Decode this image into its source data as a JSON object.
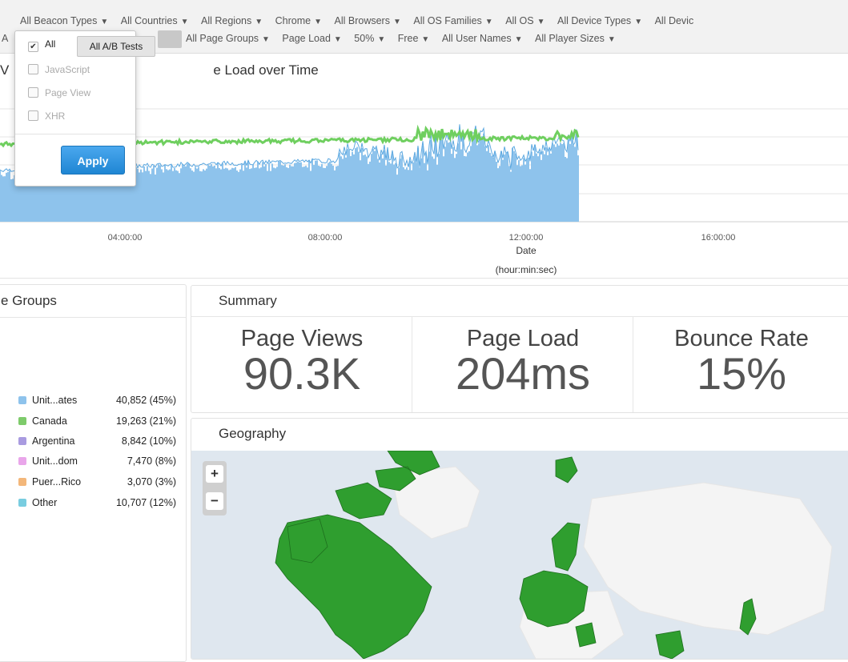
{
  "filters": {
    "row1": [
      "All Beacon Types",
      "All Countries",
      "All Regions",
      "Chrome",
      "All Browsers",
      "All OS Families",
      "All OS",
      "All Device Types",
      "All Devic"
    ],
    "row2_partial": "A",
    "row2": [
      "All Page Groups",
      "Page Load",
      "50%",
      "Free",
      "All User Names",
      "All Player Sizes"
    ]
  },
  "ab_dropdown": {
    "options": [
      {
        "label": "All",
        "checked": true
      },
      {
        "label": "JavaScript",
        "checked": false
      },
      {
        "label": "Page View",
        "checked": false
      },
      {
        "label": "XHR",
        "checked": false
      }
    ],
    "apply_label": "Apply",
    "tooltip": "All A/B Tests"
  },
  "chart": {
    "title_partial_1": "V",
    "title_partial_2": "e Load over Time",
    "xticks": [
      "04:00:00",
      "08:00:00",
      "12:00:00",
      "16:00:00"
    ],
    "xlabel": "Date",
    "xlabel_sub": "(hour:min:sec)",
    "colors": {
      "views": "#8ec3ec",
      "load": "#6fcf5f"
    }
  },
  "page_groups": {
    "title": "e Groups",
    "items": [
      {
        "name": "Unit...ates",
        "value": "40,852 (45%)",
        "color": "#8ec3ec"
      },
      {
        "name": "Canada",
        "value": "19,263 (21%)",
        "color": "#7ecb6b"
      },
      {
        "name": "Argentina",
        "value": "8,842 (10%)",
        "color": "#a99be0"
      },
      {
        "name": "Unit...dom",
        "value": "7,470  (8%)",
        "color": "#e9a6ea"
      },
      {
        "name": "Puer...Rico",
        "value": "3,070  (3%)",
        "color": "#f3b77a"
      },
      {
        "name": "Other",
        "value": "10,707 (12%)",
        "color": "#79cde0"
      }
    ]
  },
  "summary": {
    "title": "Summary",
    "metrics": [
      {
        "label": "Page Views",
        "value": "90.3K"
      },
      {
        "label": "Page Load",
        "value": "204ms"
      },
      {
        "label": "Bounce Rate",
        "value": "15%"
      }
    ]
  },
  "geography": {
    "title": "Geography",
    "zoom_in": "+",
    "zoom_out": "−",
    "colors": {
      "land": "#2f9e2f",
      "inactive": "#f4f4f4",
      "water": "#dfe7ef"
    }
  }
}
